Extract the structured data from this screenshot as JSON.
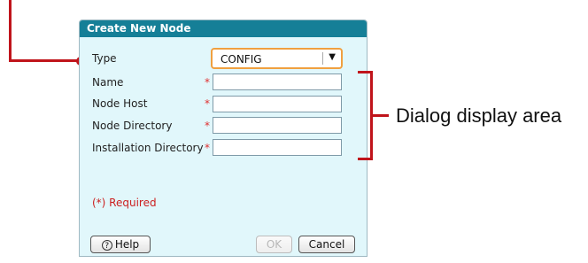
{
  "dialog": {
    "title": "Create New Node",
    "fields": [
      {
        "label": "Type",
        "value": "CONFIG",
        "required": false
      },
      {
        "label": "Name",
        "value": "",
        "required": true
      },
      {
        "label": "Node Host",
        "value": "",
        "required": true
      },
      {
        "label": "Node Directory",
        "value": "",
        "required": true
      },
      {
        "label": "Installation Directory",
        "value": "",
        "required": true
      }
    ],
    "required_marker": "*",
    "required_note": "(*) Required",
    "buttons": {
      "help": "Help",
      "help_icon": "?",
      "ok": "OK",
      "cancel": "Cancel"
    }
  },
  "annotation": {
    "label": "Dialog display area"
  },
  "colors": {
    "callout": "#c0141b",
    "titlebar": "#157f97",
    "dialog_bg": "#e1f7fb",
    "select_border": "#f0a040"
  }
}
